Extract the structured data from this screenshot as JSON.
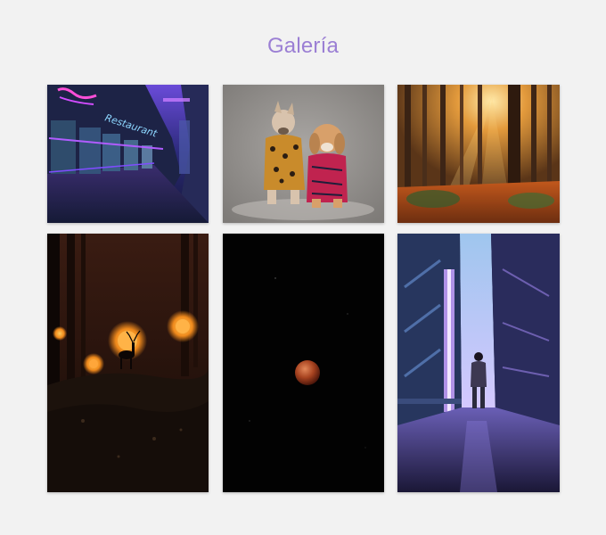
{
  "page": {
    "title": "Galería"
  },
  "gallery": {
    "photos": [
      {
        "subject": "neon-storefront-street"
      },
      {
        "subject": "two-dogs-in-sweaters"
      },
      {
        "subject": "sunlit-autumn-forest"
      },
      {
        "subject": "deer-in-dark-forest-with-lights"
      },
      {
        "subject": "blood-moon-night-sky"
      },
      {
        "subject": "person-in-neon-alley"
      }
    ],
    "neon_sign_text": "Restaurant"
  },
  "colors": {
    "title": "#9b7fd4",
    "background": "#f2f2f2"
  }
}
